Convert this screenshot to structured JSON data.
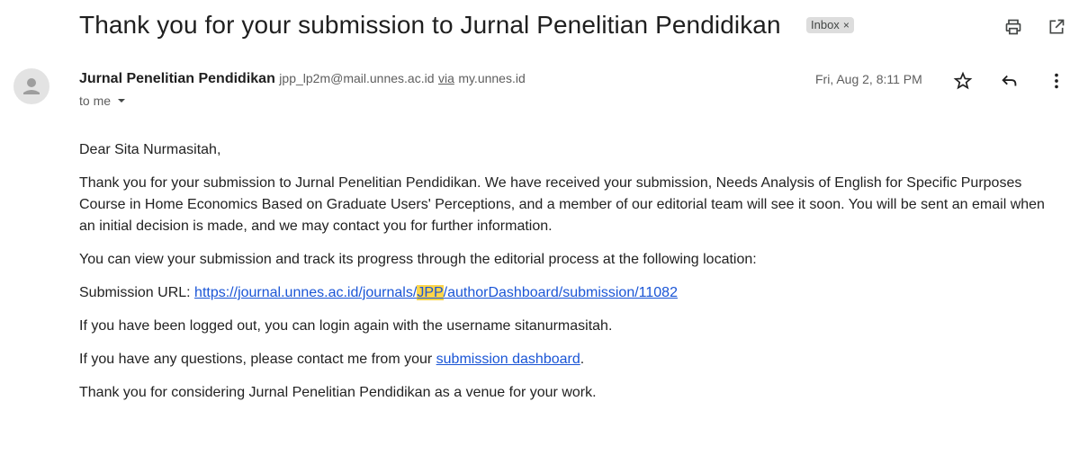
{
  "email": {
    "subject": "Thank you for your submission to Jurnal Penelitian Pendidikan",
    "label": "Inbox",
    "label_close": "×",
    "sender_name": "Jurnal Penelitian Pendidikan",
    "sender_email": "jpp_lp2m@mail.unnes.ac.id",
    "via_label": "via",
    "via_domain": "my.unnes.id",
    "to": "to me",
    "date": "Fri, Aug 2, 8:11 PM"
  },
  "icons": {
    "print": "print-icon",
    "new_window": "open-in-new-window-icon",
    "star": "star-icon",
    "reply": "reply-icon",
    "more": "more-vert-icon",
    "avatar": "person-icon",
    "caret": "chevron-down-icon"
  },
  "body": {
    "greeting": "Dear Sita Nurmasitah,",
    "para1": "Thank you for your submission to Jurnal Penelitian Pendidikan. We have received your submission, Needs Analysis of English for Specific Purposes Course in Home Economics Based on Graduate Users' Perceptions, and a member of our editorial team will see it soon. You will be sent an email when an initial decision is made, and we may contact you for further information.",
    "para2": "You can view your submission and track its progress through the editorial process at the following location:",
    "url_label": "Submission URL: ",
    "url_part1": "https://journal.unnes.ac.id/journals/",
    "url_highlight": "JPP",
    "url_part2": "/authorDashboard/submission/11082",
    "para3": "If you have been logged out, you can login again with the username sitanurmasitah.",
    "para4_prefix": "If you have any questions, please contact me from your ",
    "para4_link": "submission dashboard",
    "para4_suffix": ".",
    "para5": "Thank you for considering Jurnal Penelitian Pendidikan as a venue for your work."
  },
  "colors": {
    "link": "#1a55d6",
    "highlight": "#fcd54a",
    "label_bg": "#dddddd"
  }
}
